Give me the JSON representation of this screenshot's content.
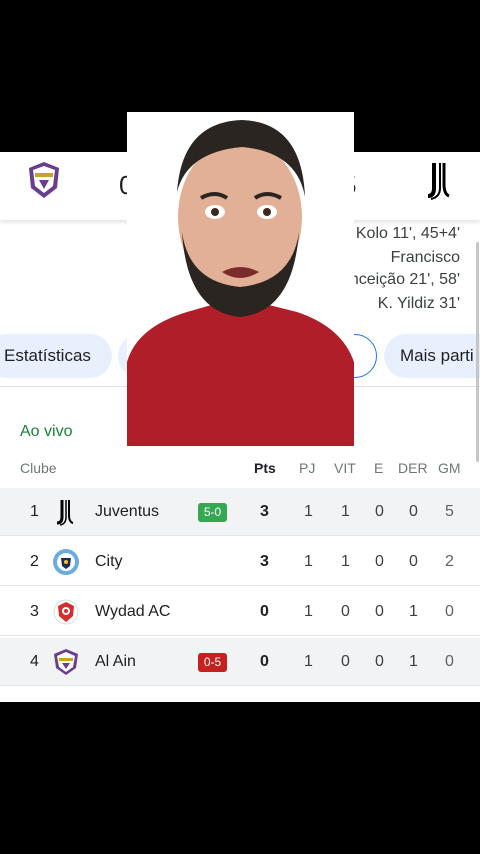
{
  "match": {
    "home_score": "0",
    "away_score": "5",
    "home_team": "Al Ain",
    "away_team": "Juventus"
  },
  "scorers": [
    "R. Kolo 11', 45+4'",
    "Francisco",
    "Conceição 21', 58'",
    "K. Yildiz 31'"
  ],
  "tabs": {
    "stats": "Estatísticas",
    "active_fragment": "o",
    "more": "Mais parti"
  },
  "live_label": "Ao vivo",
  "table": {
    "headers": {
      "club": "Clube",
      "pts": "Pts",
      "pj": "PJ",
      "vit": "VIT",
      "e": "E",
      "der": "DER",
      "gm": "GM"
    },
    "rows": [
      {
        "pos": "1",
        "name": "Juventus",
        "badge": "5-0",
        "pts": "3",
        "pj": "1",
        "vit": "1",
        "e": "0",
        "der": "0",
        "gm": "5"
      },
      {
        "pos": "2",
        "name": "City",
        "badge": "",
        "pts": "3",
        "pj": "1",
        "vit": "1",
        "e": "0",
        "der": "0",
        "gm": "2"
      },
      {
        "pos": "3",
        "name": "Wydad AC",
        "badge": "",
        "pts": "0",
        "pj": "1",
        "vit": "0",
        "e": "0",
        "der": "1",
        "gm": "0"
      },
      {
        "pos": "4",
        "name": "Al Ain",
        "badge": "0-5",
        "pts": "0",
        "pj": "1",
        "vit": "0",
        "e": "0",
        "der": "1",
        "gm": "0"
      }
    ]
  },
  "colors": {
    "live_green": "#188038",
    "win_badge": "#34a853",
    "loss_badge": "#c5221f",
    "tab_bg": "#e8f0fe",
    "tab_active_border": "#1a73e8",
    "al_ain_purple": "#6a3d8f"
  },
  "icons": {
    "home_logo": "al-ain-crest-icon",
    "away_logo": "juventus-logo-icon",
    "city_logo": "manchester-city-crest-icon",
    "wydad_logo": "wydad-crest-icon"
  }
}
